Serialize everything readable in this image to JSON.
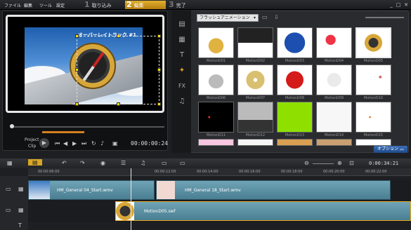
{
  "menu": [
    "ファイル",
    "編集",
    "ツール",
    "設定"
  ],
  "steps": [
    {
      "num": "1",
      "label": "取り込み"
    },
    {
      "num": "2",
      "label": "編集"
    },
    {
      "num": "3",
      "label": "完了"
    }
  ],
  "preview": {
    "overlay_label": "オーバーレイトラック #1",
    "project_label": "Project",
    "clip_label": "Clip",
    "timecode": "00:00:00:24"
  },
  "library": {
    "category": "フラッシュアニメーション",
    "options_label": "オプション",
    "thumbs": [
      {
        "caption": "MotionD01",
        "kind": "crown"
      },
      {
        "caption": "MotionD02",
        "kind": "clapper"
      },
      {
        "caption": "MotionD03",
        "kind": "globe"
      },
      {
        "caption": "MotionD04",
        "kind": "balloons"
      },
      {
        "caption": "MotionD05",
        "kind": "compass"
      },
      {
        "caption": "MotionD06",
        "kind": "cloud"
      },
      {
        "caption": "MotionD07",
        "kind": "disc"
      },
      {
        "caption": "MotionD08",
        "kind": "heart"
      },
      {
        "caption": "MotionD09",
        "kind": "spiral"
      },
      {
        "caption": "MotionD10",
        "kind": "dots"
      },
      {
        "caption": "MotionD11",
        "kind": "black-dots"
      },
      {
        "caption": "MotionD12",
        "kind": "film"
      },
      {
        "caption": "MotionD13",
        "kind": "green"
      },
      {
        "caption": "MotionD14",
        "kind": "white"
      },
      {
        "caption": "MotionD15",
        "kind": "sparkle"
      }
    ]
  },
  "timeline": {
    "timecode": "0:00:34:21",
    "ticks": [
      "00:00:00:00",
      "00:00:06:00",
      "00:00:12:00",
      "00:00:18:00",
      "00:00:14:00",
      "00:00:16:00",
      "00:00:20:00",
      "00:00:22:00",
      "00:00:24:00"
    ],
    "video_clips": [
      {
        "label": "HM_General 04_Start.wmv"
      },
      {
        "label": "HM_General 18_Start.wmv"
      }
    ],
    "overlay_clip": "MotionD05.swf"
  }
}
